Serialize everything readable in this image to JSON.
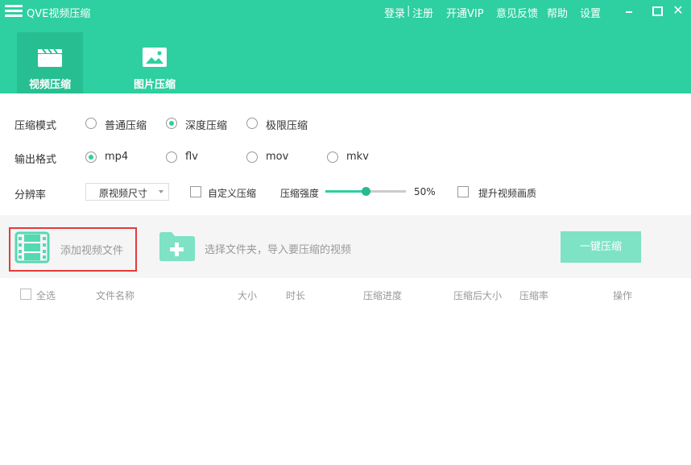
{
  "app": {
    "title": "QVE视频压缩"
  },
  "top_links": {
    "login": "登录",
    "separator": "|",
    "register": "注册",
    "vip": "开通VIP",
    "feedback": "意见反馈",
    "help": "帮助",
    "settings": "设置"
  },
  "window": {
    "close_glyph": "✕"
  },
  "tabs": [
    {
      "label": "视频压缩",
      "icon": "clapperboard-icon",
      "active": true
    },
    {
      "label": "图片压缩",
      "icon": "image-icon",
      "active": false
    }
  ],
  "settings": {
    "mode": {
      "label": "压缩模式",
      "options": [
        "普通压缩",
        "深度压缩",
        "极限压缩"
      ],
      "selected": "深度压缩"
    },
    "format": {
      "label": "输出格式",
      "options": [
        "mp4",
        "flv",
        "mov",
        "mkv"
      ],
      "selected": "mp4"
    },
    "resolution": {
      "label": "分辨率",
      "value": "原视频尺寸",
      "custom_label": "自定义压缩",
      "strength_label": "压缩强度",
      "strength_value": 50,
      "strength_text": "50%",
      "enhance_label": "提升视频画质"
    }
  },
  "actions": {
    "add_video": "添加视频文件",
    "select_folder": "选择文件夹，导入要压缩的视频",
    "one_key": "一键压缩"
  },
  "table": {
    "select_all": "全选",
    "columns": [
      "文件名称",
      "大小",
      "时长",
      "压缩进度",
      "压缩后大小",
      "压缩率",
      "操作"
    ]
  },
  "colors": {
    "accent": "#2ecfa0",
    "accent_dark": "#27bf92",
    "highlight_border": "#e33b3b",
    "button_disabled": "#7ee2c4"
  }
}
